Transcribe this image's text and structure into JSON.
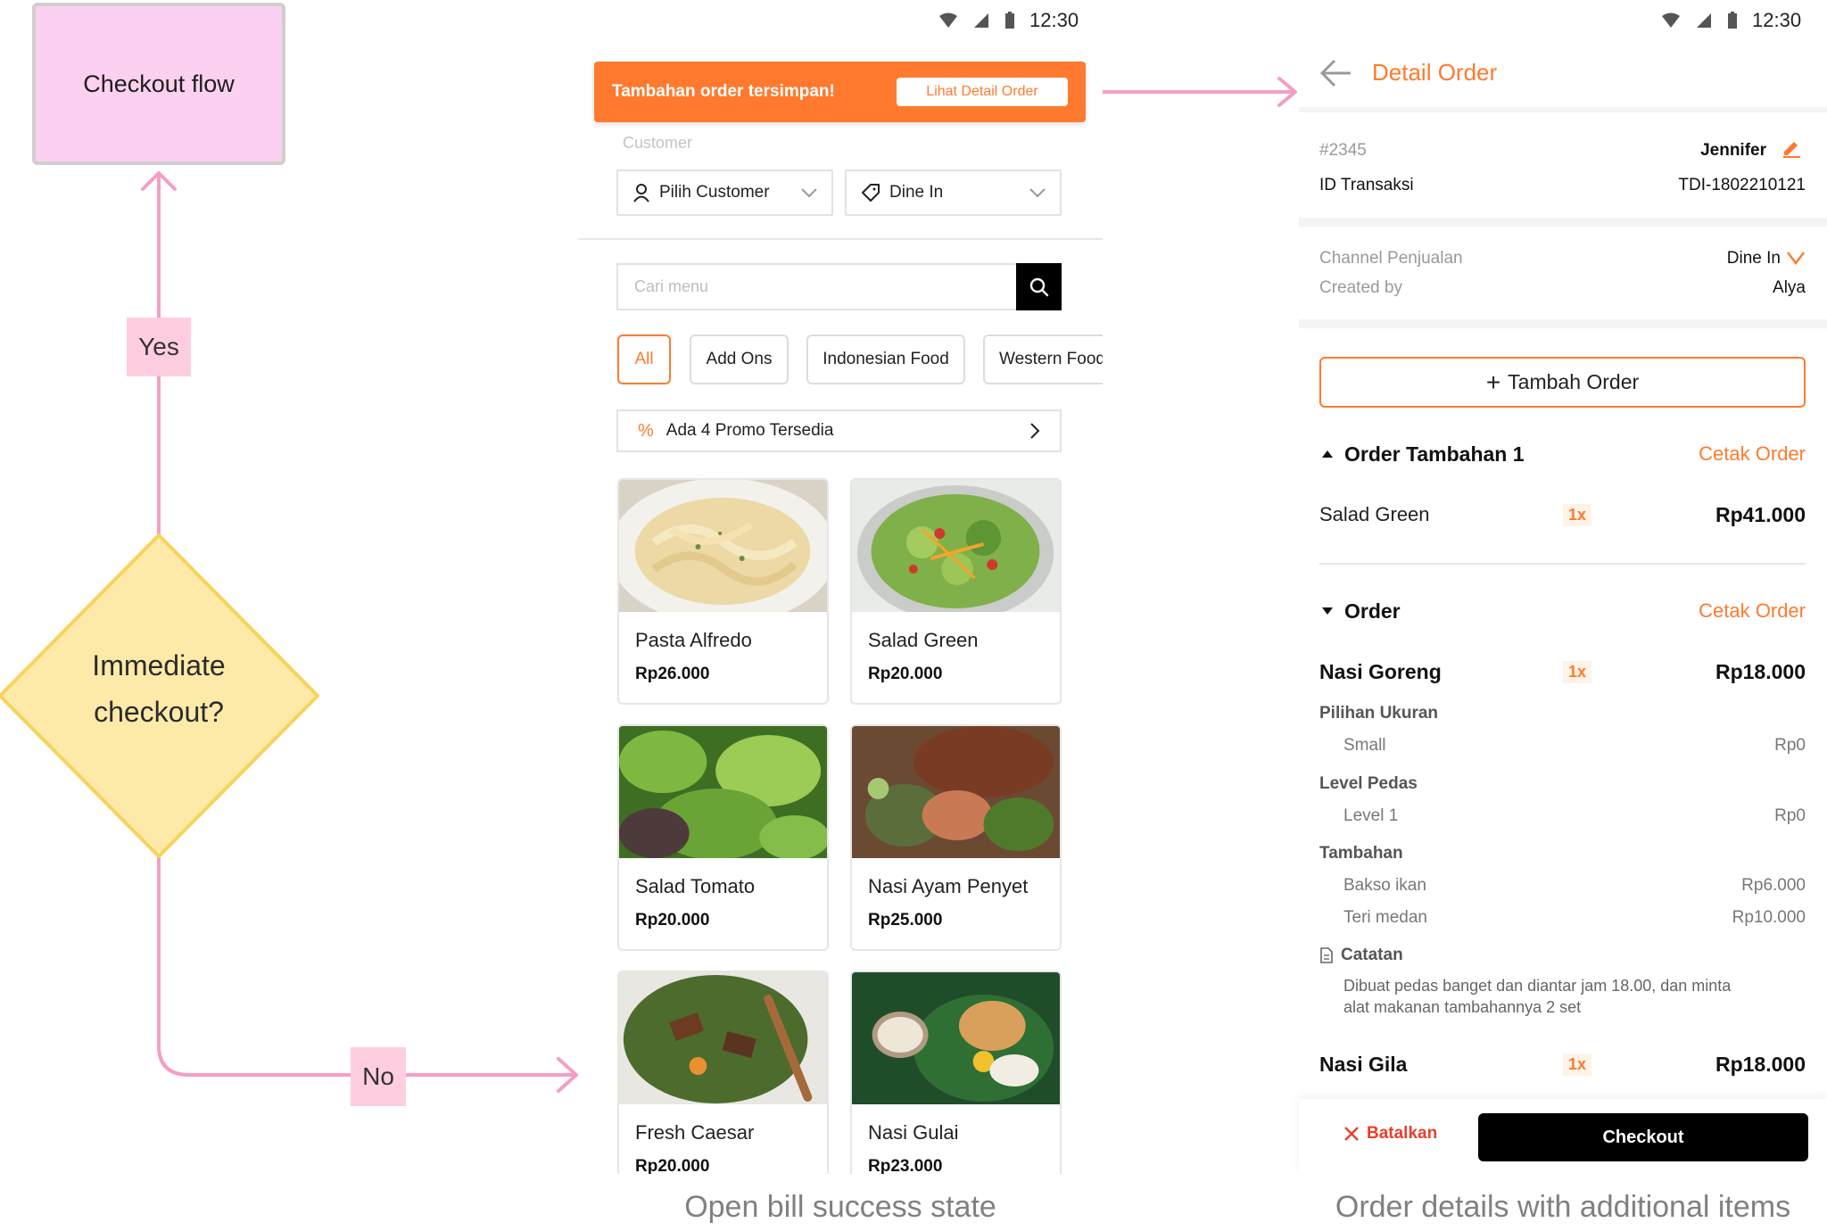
{
  "diagram": {
    "start_node": "Checkout flow",
    "decision_node": "Immediate checkout?",
    "yes_label": "Yes",
    "no_label": "No",
    "colors": {
      "start_fill": "#fcd0f0",
      "decision_fill": "#feeaa8",
      "decision_stroke": "#f7d35a",
      "arrow": "#f59ec5",
      "label_fill": "#ffcde0",
      "accent": "#ff7a2e"
    }
  },
  "screen1": {
    "status_time": "12:30",
    "toast_text": "Tambahan order tersimpan!",
    "toast_button": "Lihat Detail Order",
    "customer_label": "Customer",
    "customer_select": "Pilih Customer",
    "order_type_select": "Dine In",
    "search_placeholder": "Cari menu",
    "categories": [
      "All",
      "Add Ons",
      "Indonesian Food",
      "Western Food"
    ],
    "promo_text": "Ada 4 Promo Tersedia",
    "menu": [
      {
        "name": "Pasta Alfredo",
        "price": "Rp26.000"
      },
      {
        "name": "Salad Green",
        "price": "Rp20.000"
      },
      {
        "name": "Salad Tomato",
        "price": "Rp20.000"
      },
      {
        "name": "Nasi Ayam Penyet",
        "price": "Rp25.000"
      },
      {
        "name": "Fresh Caesar",
        "price": "Rp20.000"
      },
      {
        "name": "Nasi Gulai",
        "price": "Rp23.000"
      }
    ],
    "caption": "Open bill success state"
  },
  "screen2": {
    "status_time": "12:30",
    "title": "Detail Order",
    "order_no": "#2345",
    "customer_name": "Jennifer",
    "transaction_label": "ID Transaksi",
    "transaction_id": "TDI-1802210121",
    "channel_label": "Channel Penjualan",
    "channel_value": "Dine In",
    "created_by_label": "Created by",
    "created_by_value": "Alya",
    "add_order_button": "Tambah Order",
    "print_label": "Cetak Order",
    "extra_order_title": "Order Tambahan 1",
    "extra_item": {
      "name": "Salad Green",
      "qty": "1x",
      "price": "Rp41.000"
    },
    "order_title": "Order",
    "item1": {
      "name": "Nasi Goreng",
      "qty": "1x",
      "price": "Rp18.000"
    },
    "size_label": "Pilihan Ukuran",
    "size_value": "Small",
    "size_price": "Rp0",
    "spice_label": "Level Pedas",
    "spice_value": "Level 1",
    "spice_price": "Rp0",
    "extras_label": "Tambahan",
    "extras": [
      {
        "name": "Bakso ikan",
        "price": "Rp6.000"
      },
      {
        "name": "Teri medan",
        "price": "Rp10.000"
      }
    ],
    "note_label": "Catatan",
    "note_line1": "Dibuat pedas banget dan diantar jam 18.00, dan minta",
    "note_line2": "alat makanan tambahannya 2 set",
    "item2": {
      "name": "Nasi Gila",
      "qty": "1x",
      "price": "Rp18.000"
    },
    "cancel_button": "Batalkan",
    "checkout_button": "Checkout",
    "caption": "Order details with additional items"
  }
}
